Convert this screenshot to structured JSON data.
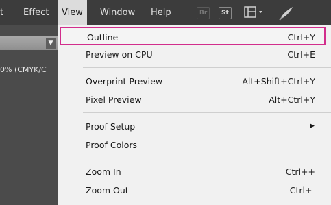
{
  "menubar": {
    "items": [
      "t",
      "Effect",
      "View",
      "Window",
      "Help"
    ],
    "bridge_badge": "Br",
    "stock_badge": "St"
  },
  "left_panel": {
    "doc_tab": "0% (CMYK/C"
  },
  "view_menu": {
    "items": [
      {
        "label": "Outline",
        "shortcut": "Ctrl+Y"
      },
      {
        "label": "Preview on CPU",
        "shortcut": "Ctrl+E"
      },
      {
        "label": "Overprint Preview",
        "shortcut": "Alt+Shift+Ctrl+Y"
      },
      {
        "label": "Pixel Preview",
        "shortcut": "Alt+Ctrl+Y"
      },
      {
        "label": "Proof Setup",
        "shortcut": ""
      },
      {
        "label": "Proof Colors",
        "shortcut": ""
      },
      {
        "label": "Zoom In",
        "shortcut": "Ctrl++"
      },
      {
        "label": "Zoom Out",
        "shortcut": "Ctrl+-"
      }
    ]
  },
  "colors": {
    "highlight_border": "#d22d8c",
    "menu_bg": "#f1f1f1",
    "menubar_bg": "#3c3c3c"
  }
}
